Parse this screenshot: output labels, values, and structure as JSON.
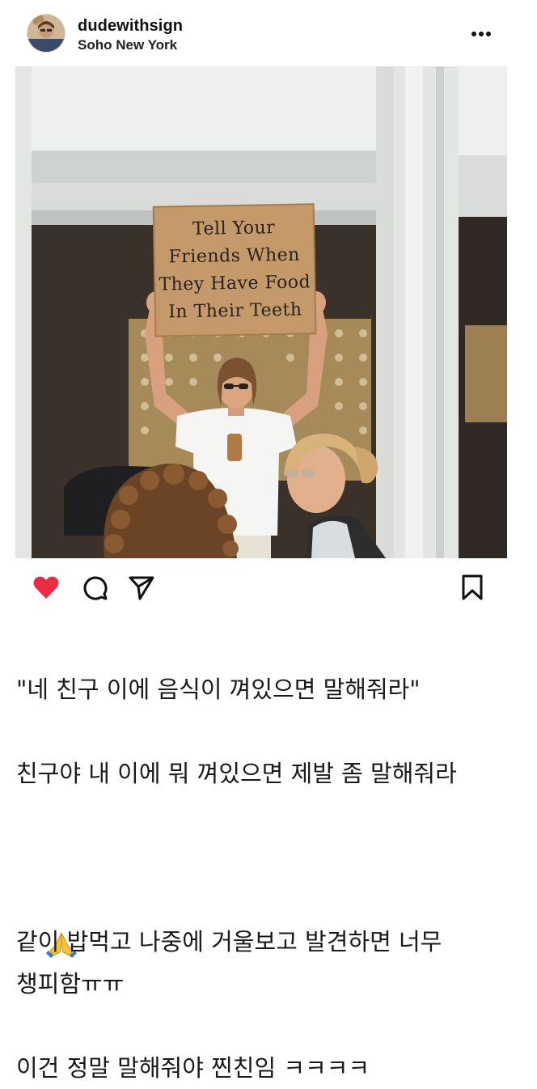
{
  "post": {
    "username": "dudewithsign",
    "location": "Soho New York"
  },
  "photo": {
    "sign_lines": [
      "Tell Your",
      "Friends When",
      "They Have Food",
      "In Their Teeth"
    ]
  },
  "actions": {
    "liked": true,
    "like_color": "#ed2b45"
  },
  "caption": {
    "line1": "\"네 친구 이에 음식이 껴있으면 말해줘라\"",
    "line2": "친구야 내 이에 뭐 껴있으면 제발 좀 말해줘라",
    "line2_emoji": "folded-hands-emoji",
    "line3": "같이 밥먹고 나중에 거울보고 발견하면 너무",
    "line4": "챙피함ㅠㅠ",
    "line5": "이건 정말 말해줘야 찐친임 ㅋㅋㅋㅋ"
  }
}
